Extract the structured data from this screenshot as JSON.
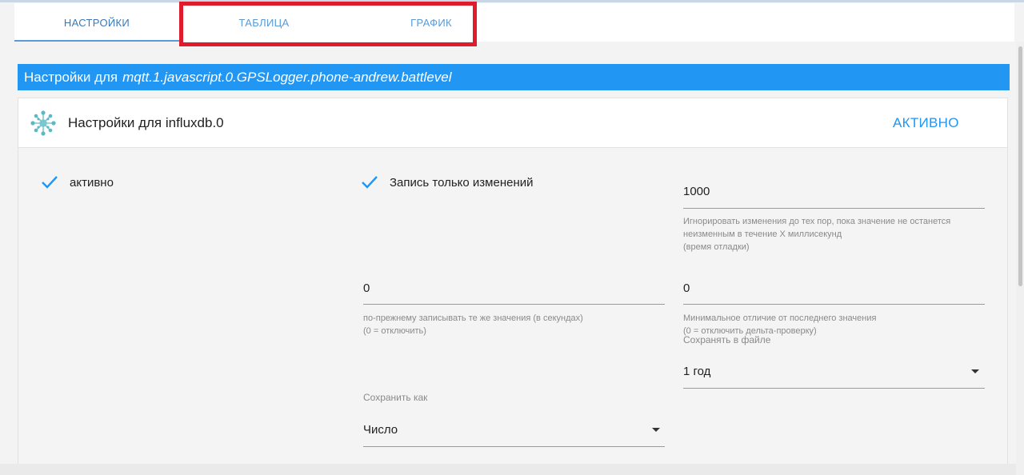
{
  "tabs": [
    {
      "label": "НАСТРОЙКИ",
      "active": true
    },
    {
      "label": "ТАБЛИЦА",
      "active": false
    },
    {
      "label": "ГРАФИК",
      "active": false
    }
  ],
  "header": {
    "prefix": "Настройки для",
    "object_id": "mqtt.1.javascript.0.GPSLogger.phone-andrew.battlevel"
  },
  "card": {
    "title": "Настройки для influxdb.0",
    "status": "АКТИВНО",
    "icon": "influxdb-logo-icon"
  },
  "fields": {
    "enabled": {
      "label": "активно",
      "checked": true
    },
    "changes_only": {
      "label": "Запись только изменений",
      "checked": true
    },
    "debounce": {
      "value": "1000",
      "help": [
        "Игнорировать изменения до тех пор, пока значение не останется",
        "неизменным в течение X миллисекунд",
        "(время отладки)"
      ]
    },
    "still_write": {
      "value": "0",
      "help": [
        "по-прежнему записывать те же значения (в секундах)",
        "(0 = отключить)"
      ]
    },
    "min_delta": {
      "value": "0",
      "help": [
        "Минимальное отличие от последнего значения",
        "(0 = отключить дельта-проверку)"
      ]
    },
    "retention": {
      "label": "Сохранять в файле",
      "value": "1 год"
    },
    "store_as": {
      "label": "Сохранить как",
      "value": "Число"
    }
  },
  "colors": {
    "accent": "#2196f3",
    "tab_text": "#5a9ad6",
    "highlight": "#e01b2b"
  }
}
